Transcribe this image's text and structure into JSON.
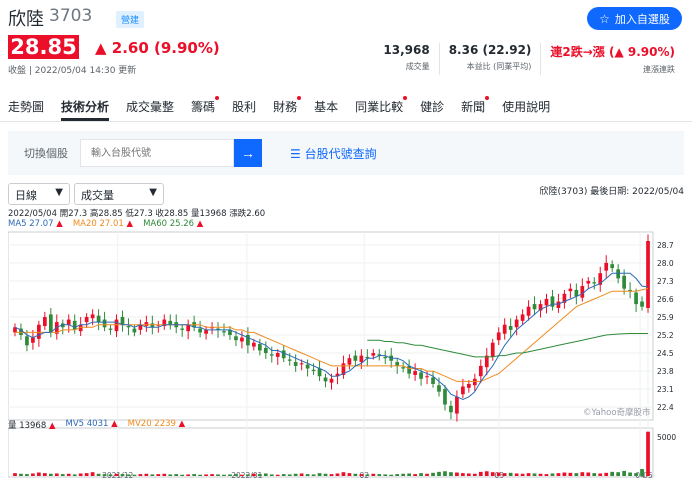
{
  "header": {
    "name": "欣陸",
    "code": "3703",
    "badge": "營建",
    "follow_label": "加入自選股"
  },
  "quote": {
    "price": "28.85",
    "change": "▲ 2.60 (9.90%)",
    "updated": "收盤 | 2022/05/04 14:30 更新"
  },
  "stats": [
    {
      "value": "13,968",
      "label": "成交量"
    },
    {
      "value": "8.36 (22.92)",
      "label": "本益比 (同業平均)"
    },
    {
      "value": "連2跌→漲 (▲ 9.90%)",
      "label": "連漲連跌"
    }
  ],
  "nav": {
    "items": [
      {
        "label": "走勢圖",
        "dot": false
      },
      {
        "label": "技術分析",
        "dot": false
      },
      {
        "label": "成交彙整",
        "dot": false
      },
      {
        "label": "籌碼",
        "dot": true
      },
      {
        "label": "股利",
        "dot": false
      },
      {
        "label": "財務",
        "dot": true
      },
      {
        "label": "基本",
        "dot": false
      },
      {
        "label": "同業比較",
        "dot": true
      },
      {
        "label": "健診",
        "dot": false
      },
      {
        "label": "新聞",
        "dot": true
      },
      {
        "label": "使用說明",
        "dot": false
      }
    ],
    "active_index": 1
  },
  "search": {
    "label": "切換個股",
    "placeholder": "輸入台股代號",
    "lookup_label": "台股代號查詢"
  },
  "controls": {
    "period": "日線",
    "indicator": "成交量",
    "info": "欣陸(3703)   最後日期: 2022/05/04"
  },
  "ohlc_text": "2022/05/04 開27.3 高28.85 低27.3 收28.85 量13968 漲跌2.60",
  "ma": {
    "ma5": "MA5 27.07",
    "ma20": "MA20 27.01",
    "ma60": "MA60 25.26"
  },
  "volume_legend": {
    "vol": "量 13968",
    "mv5": "MV5 4031",
    "mv20": "MV20 2239"
  },
  "watermark": "©Yahoo奇摩股市",
  "colors": {
    "up": "#eb0f29",
    "down": "#2f8a3a",
    "ma5": "#2a6ab5",
    "ma20": "#f08a1e",
    "ma60": "#2f8a3a",
    "accent": "#0f69ff"
  },
  "chart_data": {
    "type": "line",
    "y_ticks": [
      "28.7",
      "28.0",
      "27.3",
      "26.6",
      "25.9",
      "25.2",
      "24.5",
      "23.8",
      "23.1",
      "22.4"
    ],
    "ylim": [
      21.9,
      29.2
    ],
    "x_labels": [
      "2021/12",
      "2022/01",
      "02",
      "03",
      "04",
      "05"
    ],
    "vol_tick": "5000",
    "vol_max": 14500,
    "close": [
      25.5,
      25.2,
      24.8,
      25.1,
      25.6,
      25.9,
      25.3,
      25.7,
      25.5,
      25.8,
      25.4,
      25.6,
      25.9,
      26.0,
      25.7,
      25.5,
      25.4,
      25.8,
      25.6,
      25.5,
      25.3,
      25.6,
      25.7,
      25.5,
      25.6,
      25.8,
      25.6,
      25.5,
      25.4,
      25.6,
      25.5,
      25.3,
      25.4,
      25.5,
      25.4,
      25.3,
      25.2,
      25.0,
      25.1,
      24.8,
      24.9,
      24.6,
      24.5,
      24.4,
      24.5,
      24.3,
      24.2,
      24.0,
      24.1,
      23.9,
      23.8,
      23.6,
      23.4,
      23.5,
      23.7,
      24.1,
      24.3,
      24.2,
      24.4,
      24.3,
      24.5,
      24.4,
      24.3,
      24.2,
      24.0,
      23.9,
      23.7,
      23.8,
      23.5,
      23.6,
      23.3,
      23.0,
      22.5,
      22.2,
      22.8,
      23.2,
      23.3,
      23.5,
      24.0,
      24.4,
      24.9,
      25.3,
      25.6,
      25.4,
      25.8,
      26.0,
      26.3,
      26.2,
      26.4,
      26.6,
      26.3,
      26.5,
      26.8,
      27.0,
      26.7,
      27.1,
      27.3,
      27.2,
      27.6,
      28.0,
      27.8,
      27.4,
      27.0,
      26.9,
      26.4,
      26.3,
      28.85
    ],
    "ma5": [
      25.5,
      25.4,
      25.2,
      25.1,
      25.2,
      25.3,
      25.3,
      25.5,
      25.6,
      25.6,
      25.5,
      25.6,
      25.6,
      25.7,
      25.7,
      25.7,
      25.7,
      25.7,
      25.6,
      25.6,
      25.5,
      25.6,
      25.5,
      25.5,
      25.5,
      25.6,
      25.6,
      25.6,
      25.6,
      25.6,
      25.5,
      25.5,
      25.4,
      25.4,
      25.4,
      25.4,
      25.4,
      25.3,
      25.2,
      25.1,
      25.0,
      24.9,
      24.8,
      24.6,
      24.6,
      24.5,
      24.4,
      24.3,
      24.2,
      24.1,
      24.0,
      23.9,
      23.8,
      23.6,
      23.6,
      23.7,
      23.8,
      24.0,
      24.1,
      24.3,
      24.3,
      24.4,
      24.4,
      24.3,
      24.3,
      24.2,
      24.0,
      23.9,
      23.8,
      23.7,
      23.6,
      23.4,
      23.2,
      22.9,
      22.8,
      22.7,
      22.8,
      23.0,
      23.4,
      23.7,
      24.0,
      24.4,
      24.8,
      25.1,
      25.4,
      25.6,
      25.8,
      26.0,
      26.2,
      26.3,
      26.4,
      26.4,
      26.5,
      26.6,
      26.7,
      26.8,
      27.0,
      27.1,
      27.2,
      27.4,
      27.6,
      27.6,
      27.6,
      27.6,
      27.4,
      27.1,
      27.07
    ],
    "ma20": [
      25.3,
      25.3,
      25.3,
      25.3,
      25.3,
      25.3,
      25.3,
      25.3,
      25.4,
      25.4,
      25.4,
      25.5,
      25.5,
      25.5,
      25.6,
      25.6,
      25.6,
      25.6,
      25.6,
      25.6,
      25.6,
      25.6,
      25.6,
      25.6,
      25.6,
      25.6,
      25.6,
      25.6,
      25.6,
      25.6,
      25.6,
      25.6,
      25.5,
      25.5,
      25.5,
      25.5,
      25.5,
      25.4,
      25.4,
      25.3,
      25.3,
      25.2,
      25.1,
      25.0,
      24.9,
      24.8,
      24.7,
      24.6,
      24.5,
      24.4,
      24.3,
      24.2,
      24.1,
      24.0,
      24.0,
      24.0,
      24.0,
      24.0,
      24.0,
      24.0,
      24.0,
      24.0,
      24.0,
      24.0,
      24.0,
      24.0,
      23.9,
      23.9,
      23.9,
      23.8,
      23.8,
      23.7,
      23.6,
      23.5,
      23.4,
      23.4,
      23.4,
      23.4,
      23.4,
      23.5,
      23.6,
      23.7,
      23.9,
      24.1,
      24.3,
      24.5,
      24.7,
      24.9,
      25.1,
      25.3,
      25.5,
      25.7,
      25.9,
      26.1,
      26.3,
      26.4,
      26.5,
      26.6,
      26.7,
      26.8,
      26.9,
      26.9,
      26.9,
      26.9,
      26.9,
      26.95,
      27.01
    ],
    "ma60_start": 59,
    "ma60": [
      25.0,
      25.0,
      25.0,
      24.95,
      24.95,
      24.9,
      24.9,
      24.85,
      24.8,
      24.8,
      24.75,
      24.7,
      24.65,
      24.6,
      24.55,
      24.5,
      24.45,
      24.4,
      24.35,
      24.35,
      24.35,
      24.35,
      24.4,
      24.4,
      24.45,
      24.5,
      24.5,
      24.55,
      24.6,
      24.65,
      24.7,
      24.75,
      24.8,
      24.85,
      24.9,
      24.95,
      25.0,
      25.05,
      25.1,
      25.15,
      25.2,
      25.22,
      25.24,
      25.25,
      25.26,
      25.26,
      25.26,
      25.26
    ],
    "volume": [
      900,
      700,
      600,
      800,
      1100,
      900,
      700,
      800,
      600,
      700,
      500,
      800,
      900,
      1200,
      700,
      600,
      500,
      700,
      600,
      500,
      400,
      600,
      700,
      500,
      600,
      700,
      500,
      600,
      400,
      500,
      600,
      400,
      500,
      600,
      500,
      400,
      500,
      600,
      400,
      500,
      700,
      600,
      800,
      500,
      400,
      600,
      500,
      700,
      800,
      600,
      500,
      900,
      700,
      600,
      800,
      1200,
      900,
      700,
      600,
      500,
      700,
      600,
      500,
      400,
      600,
      700,
      800,
      600,
      900,
      700,
      1000,
      1300,
      1500,
      1200,
      1100,
      900,
      800,
      700,
      1300,
      1500,
      1200,
      1100,
      900,
      1000,
      800,
      700,
      900,
      800,
      700,
      600,
      800,
      900,
      1100,
      1000,
      900,
      1200,
      1100,
      900,
      800,
      1000,
      1300,
      1200,
      1600,
      1100,
      900,
      2200,
      13968
    ]
  }
}
